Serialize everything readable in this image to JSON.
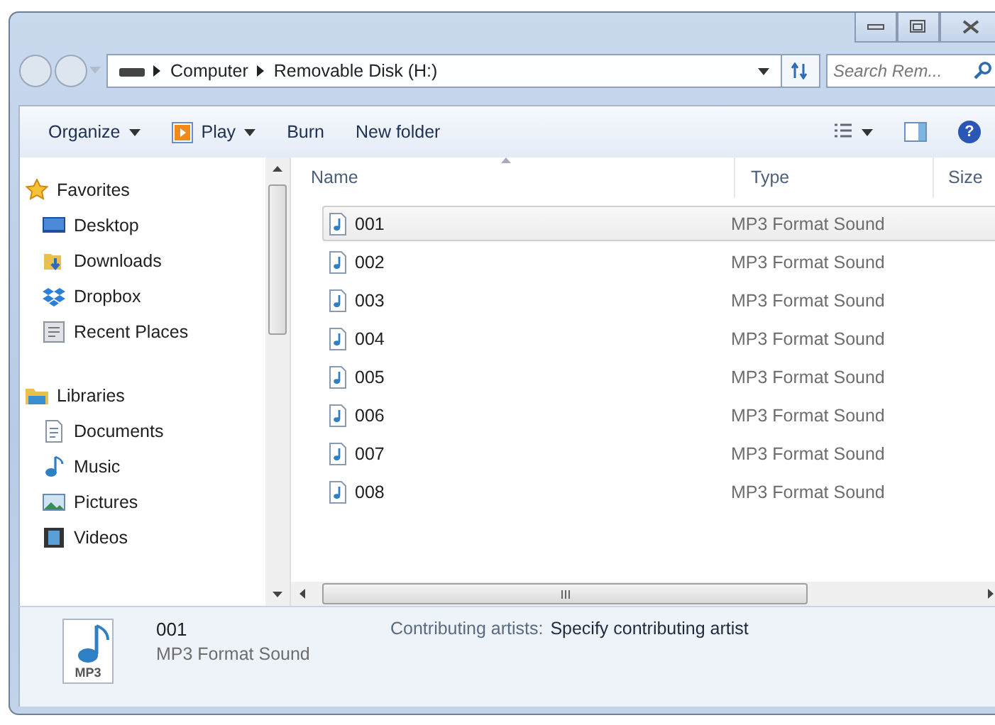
{
  "address": {
    "crumbs": [
      "Computer",
      "Removable Disk (H:)"
    ]
  },
  "search": {
    "placeholder": "Search Rem..."
  },
  "toolbar": {
    "buttons": [
      {
        "label": "Organize",
        "kind": "menu"
      },
      {
        "label": "Play",
        "kind": "play"
      },
      {
        "label": "Burn",
        "kind": "plain"
      },
      {
        "label": "New folder",
        "kind": "plain"
      }
    ],
    "help_label": "?"
  },
  "sidebar": {
    "groups": [
      {
        "label": "Favorites",
        "kind": "star",
        "children": [
          {
            "label": "Desktop",
            "kind": "desktop"
          },
          {
            "label": "Downloads",
            "kind": "downloads"
          },
          {
            "label": "Dropbox",
            "kind": "dropbox"
          },
          {
            "label": "Recent Places",
            "kind": "recent"
          }
        ]
      },
      {
        "label": "Libraries",
        "kind": "library",
        "children": [
          {
            "label": "Documents",
            "kind": "documents"
          },
          {
            "label": "Music",
            "kind": "music"
          },
          {
            "label": "Pictures",
            "kind": "pictures"
          },
          {
            "label": "Videos",
            "kind": "videos"
          }
        ]
      }
    ]
  },
  "table": {
    "columns": [
      "Name",
      "Type",
      "Size"
    ],
    "rows": [
      {
        "name": "001",
        "type": "MP3 Format Sound",
        "selected": true
      },
      {
        "name": "002",
        "type": "MP3 Format Sound",
        "selected": false
      },
      {
        "name": "003",
        "type": "MP3 Format Sound",
        "selected": false
      },
      {
        "name": "004",
        "type": "MP3 Format Sound",
        "selected": false
      },
      {
        "name": "005",
        "type": "MP3 Format Sound",
        "selected": false
      },
      {
        "name": "006",
        "type": "MP3 Format Sound",
        "selected": false
      },
      {
        "name": "007",
        "type": "MP3 Format Sound",
        "selected": false
      },
      {
        "name": "008",
        "type": "MP3 Format Sound",
        "selected": false
      }
    ]
  },
  "details": {
    "icon_label": "MP3",
    "name": "001",
    "type": "MP3 Format Sound",
    "field_label": "Contributing artists:",
    "field_value": "Specify contributing artist"
  }
}
